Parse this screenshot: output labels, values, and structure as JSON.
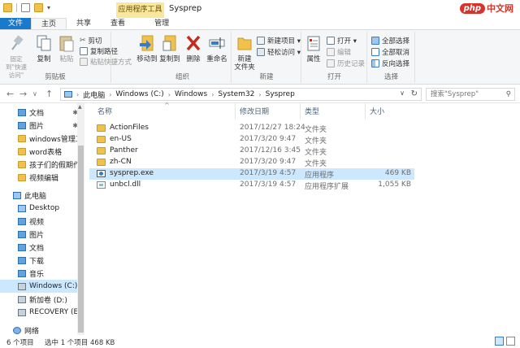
{
  "window": {
    "title": "Sysprep",
    "contextual_tab": "应用程序工具",
    "logo_badge": "php",
    "logo_text": "中文网"
  },
  "tabs": [
    {
      "label": "文件"
    },
    {
      "label": "主页"
    },
    {
      "label": "共享"
    },
    {
      "label": "查看"
    },
    {
      "label": "管理"
    }
  ],
  "ribbon": {
    "clipboard": {
      "title": "剪贴板",
      "pin": "固定到\"快速访问\"",
      "copy": "复制",
      "paste": "粘贴",
      "cut": "剪切",
      "copy_path": "复制路径",
      "paste_shortcut": "粘贴快捷方式"
    },
    "organize": {
      "title": "组织",
      "move_to": "移动到",
      "copy_to": "复制到",
      "delete": "删除",
      "rename": "重命名"
    },
    "new": {
      "title": "新建",
      "new_folder": "新建\n文件夹",
      "new_item": "新建项目 ▾",
      "easy_access": "轻松访问 ▾"
    },
    "open": {
      "title": "打开",
      "properties": "属性",
      "open": "打开 ▾",
      "edit": "编辑",
      "history": "历史记录"
    },
    "select": {
      "title": "选择",
      "select_all": "全部选择",
      "select_none": "全部取消",
      "invert": "反向选择"
    }
  },
  "address": {
    "crumbs": [
      "此电脑",
      "Windows (C:)",
      "Windows",
      "System32",
      "Sysprep"
    ],
    "search_placeholder": "搜索\"Sysprep\""
  },
  "nav": {
    "items": [
      {
        "label": "文档",
        "icon": "document-icon",
        "pinned": true
      },
      {
        "label": "图片",
        "icon": "pictures-icon",
        "pinned": true
      },
      {
        "label": "windows管理工",
        "icon": "folder-icon"
      },
      {
        "label": "word表格",
        "icon": "folder-icon"
      },
      {
        "label": "孩子们的假期作业",
        "icon": "folder-icon"
      },
      {
        "label": "视频编辑",
        "icon": "folder-icon"
      },
      {
        "label": "此电脑",
        "icon": "computer-icon"
      },
      {
        "label": "Desktop",
        "icon": "desktop-icon"
      },
      {
        "label": "视频",
        "icon": "videos-icon"
      },
      {
        "label": "图片",
        "icon": "pictures-icon"
      },
      {
        "label": "文档",
        "icon": "document-icon"
      },
      {
        "label": "下载",
        "icon": "downloads-icon"
      },
      {
        "label": "音乐",
        "icon": "music-icon"
      },
      {
        "label": "Windows (C:)",
        "icon": "drive-icon",
        "selected": true
      },
      {
        "label": "新加卷 (D:)",
        "icon": "drive-icon"
      },
      {
        "label": "RECOVERY (E:)",
        "icon": "drive-icon"
      },
      {
        "label": "网络",
        "icon": "network-icon"
      }
    ],
    "pin_glyph": "✱"
  },
  "columns": {
    "name": "名称",
    "date": "修改日期",
    "type": "类型",
    "size": "大小"
  },
  "files": [
    {
      "name": "ActionFiles",
      "date": "2017/12/27 18:24",
      "type": "文件夹",
      "size": "",
      "kind": "folder"
    },
    {
      "name": "en-US",
      "date": "2017/3/20 9:47",
      "type": "文件夹",
      "size": "",
      "kind": "folder"
    },
    {
      "name": "Panther",
      "date": "2017/12/16 3:45",
      "type": "文件夹",
      "size": "",
      "kind": "folder"
    },
    {
      "name": "zh-CN",
      "date": "2017/3/20 9:47",
      "type": "文件夹",
      "size": "",
      "kind": "folder"
    },
    {
      "name": "sysprep.exe",
      "date": "2017/3/19 4:57",
      "type": "应用程序",
      "size": "469 KB",
      "kind": "exe",
      "selected": true
    },
    {
      "name": "unbcl.dll",
      "date": "2017/3/19 4:57",
      "type": "应用程序扩展",
      "size": "1,055 KB",
      "kind": "dll"
    }
  ],
  "status": {
    "count": "6 个项目",
    "selection": "选中 1 个项目  468 KB"
  },
  "colors": {
    "file_tab": "#1979ca",
    "selection": "#cce8ff",
    "contextual_tab": "#f9e79d"
  }
}
